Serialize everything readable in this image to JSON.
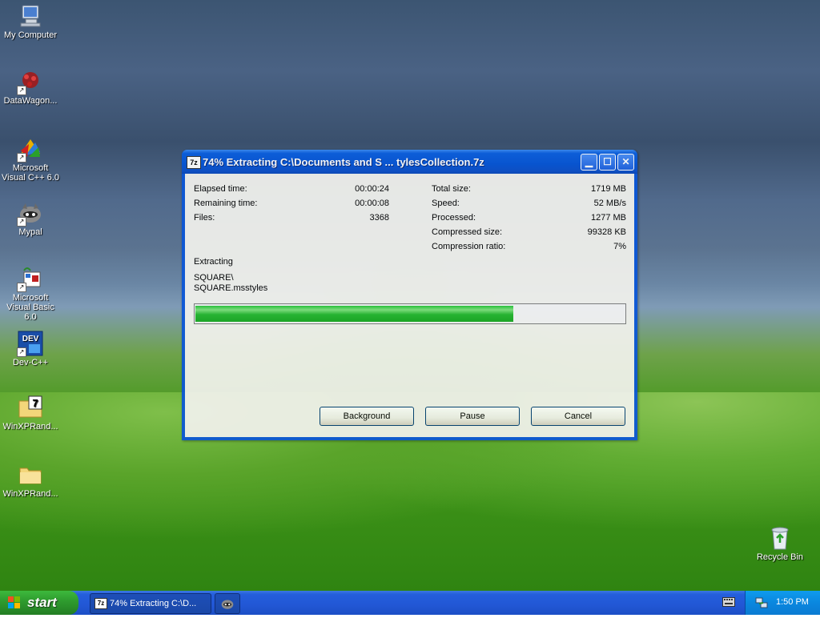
{
  "desktop": {
    "icons": [
      {
        "label": "My Computer",
        "icon": "my-computer-icon"
      },
      {
        "label": "DataWagon...",
        "icon": "datawagon-icon"
      },
      {
        "label": "Microsoft Visual C++ 6.0",
        "icon": "visual-cpp-icon"
      },
      {
        "label": "Mypal",
        "icon": "mypal-icon"
      },
      {
        "label": "Microsoft Visual Basic 6.0",
        "icon": "visual-basic-icon"
      },
      {
        "label": "Dev-C++",
        "icon": "dev-cpp-icon"
      },
      {
        "label": "WinXPRand...",
        "icon": "7z-archive-icon"
      },
      {
        "label": "WinXPRand...",
        "icon": "folder-icon"
      },
      {
        "label": "Recycle Bin",
        "icon": "recycle-bin-icon"
      }
    ]
  },
  "dialog": {
    "title_icon_text": "7z",
    "title": "74% Extracting C:\\Documents and S ... tylesCollection.7z",
    "left_stats": [
      {
        "label": "Elapsed time:",
        "value": "00:00:24"
      },
      {
        "label": "Remaining time:",
        "value": "00:00:08"
      },
      {
        "label": "Files:",
        "value": "3368"
      }
    ],
    "right_stats": [
      {
        "label": "Total size:",
        "value": "1719 MB"
      },
      {
        "label": "Speed:",
        "value": "52 MB/s"
      },
      {
        "label": "Processed:",
        "value": "1277 MB"
      },
      {
        "label": "Compressed size:",
        "value": "99328 KB"
      },
      {
        "label": "Compression ratio:",
        "value": "7%"
      }
    ],
    "status_label": "Extracting",
    "current_path": "SQUARE\\",
    "current_file": "SQUARE.msstyles",
    "progress_percent": 74,
    "buttons": {
      "background": "Background",
      "pause": "Pause",
      "cancel": "Cancel"
    }
  },
  "taskbar": {
    "start_label": "start",
    "tasks": [
      {
        "label": "74% Extracting C:\\D...",
        "icon": "7z-icon"
      },
      {
        "label": "",
        "icon": "mypal-icon"
      }
    ],
    "clock": "1:50 PM"
  }
}
